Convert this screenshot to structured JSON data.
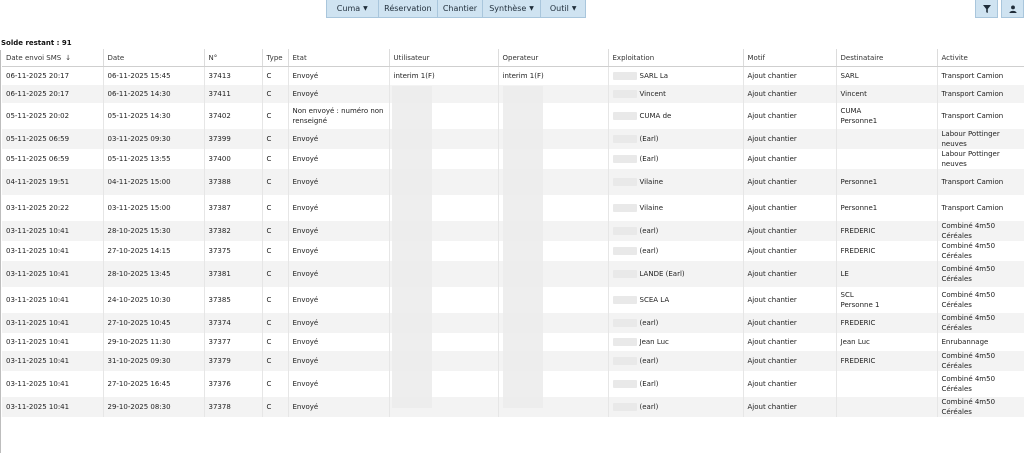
{
  "menu": [
    {
      "label": "Cuma",
      "caret": true,
      "w": 0
    },
    {
      "label": "Réservation",
      "caret": false
    },
    {
      "label": "Chantier",
      "caret": false
    },
    {
      "label": "Synthèse",
      "caret": true
    },
    {
      "label": "Outil",
      "caret": true
    }
  ],
  "solde": "Solde restant : 91",
  "columns": [
    "Date envoi SMS",
    "Date",
    "N°",
    "Type",
    "Etat",
    "Utilisateur",
    "Operateur",
    "Exploitation",
    "Motif",
    "Destinataire",
    "Activite"
  ],
  "rows": [
    {
      "date_envoi": "06-11-2025 20:17",
      "date": "06-11-2025 15:45",
      "num": "37413",
      "type": "C",
      "etat": "Envoyé",
      "utilisateur": "interim 1(F)",
      "operateur": "interim 1(F)",
      "exploitation": "SARL La",
      "motif": "Ajout chantier",
      "destinataire": "SARL",
      "destinataire2": "",
      "activite": "Transport Camion",
      "tall": false
    },
    {
      "date_envoi": "06-11-2025 20:17",
      "date": "06-11-2025 14:30",
      "num": "37411",
      "type": "C",
      "etat": "Envoyé",
      "utilisateur": "",
      "operateur": "",
      "exploitation": "Vincent",
      "motif": "Ajout chantier",
      "destinataire": "Vincent",
      "destinataire2": "",
      "activite": "Transport Camion",
      "tall": false
    },
    {
      "date_envoi": "05-11-2025 20:02",
      "date": "05-11-2025 14:30",
      "num": "37402",
      "type": "C",
      "etat": "Non envoyé : numéro non renseigné",
      "utilisateur": "",
      "operateur": "",
      "exploitation": "CUMA de",
      "motif": "Ajout chantier",
      "destinataire": "CUMA",
      "destinataire2": "Personne1",
      "activite": "Transport Camion",
      "tall": true
    },
    {
      "date_envoi": "05-11-2025 06:59",
      "date": "03-11-2025 09:30",
      "num": "37399",
      "type": "C",
      "etat": "Envoyé",
      "utilisateur": "",
      "operateur": "",
      "exploitation": "(Earl)",
      "motif": "Ajout chantier",
      "destinataire": "",
      "destinataire2": "",
      "activite": "Labour Pottinger neuves",
      "tall": false
    },
    {
      "date_envoi": "05-11-2025 06:59",
      "date": "05-11-2025 13:55",
      "num": "37400",
      "type": "C",
      "etat": "Envoyé",
      "utilisateur": "",
      "operateur": "",
      "exploitation": "(Earl)",
      "motif": "Ajout chantier",
      "destinataire": "",
      "destinataire2": "",
      "activite": "Labour Pottinger neuves",
      "tall": false
    },
    {
      "date_envoi": "04-11-2025 19:51",
      "date": "04-11-2025 15:00",
      "num": "37388",
      "type": "C",
      "etat": "Envoyé",
      "utilisateur": "",
      "operateur": "",
      "exploitation": "Vilaine",
      "motif": "Ajout chantier",
      "destinataire": "",
      "destinataire2": "Personne1",
      "activite": "Transport Camion",
      "tall": true
    },
    {
      "date_envoi": "03-11-2025 20:22",
      "date": "03-11-2025 15:00",
      "num": "37387",
      "type": "C",
      "etat": "Envoyé",
      "utilisateur": "",
      "operateur": "",
      "exploitation": "Vilaine",
      "motif": "Ajout chantier",
      "destinataire": "",
      "destinataire2": "Personne1",
      "activite": "Transport Camion",
      "tall": true
    },
    {
      "date_envoi": "03-11-2025 10:41",
      "date": "28-10-2025 15:30",
      "num": "37382",
      "type": "C",
      "etat": "Envoyé",
      "utilisateur": "",
      "operateur": "",
      "exploitation": "(earl)",
      "motif": "Ajout chantier",
      "destinataire": "FREDERIC",
      "destinataire2": "",
      "activite": "Combiné 4m50 Céréales",
      "tall": false
    },
    {
      "date_envoi": "03-11-2025 10:41",
      "date": "27-10-2025 14:15",
      "num": "37375",
      "type": "C",
      "etat": "Envoyé",
      "utilisateur": "",
      "operateur": "",
      "exploitation": "(earl)",
      "motif": "Ajout chantier",
      "destinataire": "FREDERIC",
      "destinataire2": "",
      "activite": "Combiné 4m50 Céréales",
      "tall": false
    },
    {
      "date_envoi": "03-11-2025 10:41",
      "date": "28-10-2025 13:45",
      "num": "37381",
      "type": "C",
      "etat": "Envoyé",
      "utilisateur": "",
      "operateur": "",
      "exploitation": "LANDE (Earl)",
      "motif": "Ajout chantier",
      "destinataire": "LE",
      "destinataire2": "",
      "activite": "Combiné 4m50 Céréales",
      "tall": true
    },
    {
      "date_envoi": "03-11-2025 10:41",
      "date": "24-10-2025 10:30",
      "num": "37385",
      "type": "C",
      "etat": "Envoyé",
      "utilisateur": "",
      "operateur": "",
      "exploitation": "SCEA LA",
      "motif": "Ajout chantier",
      "destinataire": "SCL",
      "destinataire2": "Personne 1",
      "activite": "Combiné 4m50 Céréales",
      "tall": true
    },
    {
      "date_envoi": "03-11-2025 10:41",
      "date": "27-10-2025 10:45",
      "num": "37374",
      "type": "C",
      "etat": "Envoyé",
      "utilisateur": "",
      "operateur": "",
      "exploitation": "(earl)",
      "motif": "Ajout chantier",
      "destinataire": "FREDERIC",
      "destinataire2": "",
      "activite": "Combiné 4m50 Céréales",
      "tall": false
    },
    {
      "date_envoi": "03-11-2025 10:41",
      "date": "29-10-2025 11:30",
      "num": "37377",
      "type": "C",
      "etat": "Envoyé",
      "utilisateur": "",
      "operateur": "",
      "exploitation": "Jean Luc",
      "motif": "Ajout chantier",
      "destinataire": "Jean Luc",
      "destinataire2": "",
      "activite": "Enrubannage",
      "tall": false
    },
    {
      "date_envoi": "03-11-2025 10:41",
      "date": "31-10-2025 09:30",
      "num": "37379",
      "type": "C",
      "etat": "Envoyé",
      "utilisateur": "",
      "operateur": "",
      "exploitation": "(earl)",
      "motif": "Ajout chantier",
      "destinataire": "FREDERIC",
      "destinataire2": "",
      "activite": "Combiné 4m50 Céréales",
      "tall": false
    },
    {
      "date_envoi": "03-11-2025 10:41",
      "date": "27-10-2025 16:45",
      "num": "37376",
      "type": "C",
      "etat": "Envoyé",
      "utilisateur": "",
      "operateur": "",
      "exploitation": "(Earl)",
      "motif": "Ajout chantier",
      "destinataire": "",
      "destinataire2": "",
      "activite": "Combiné 4m50 Céréales",
      "tall": true
    },
    {
      "date_envoi": "03-11-2025 10:41",
      "date": "29-10-2025 08:30",
      "num": "37378",
      "type": "C",
      "etat": "Envoyé",
      "utilisateur": "",
      "operateur": "",
      "exploitation": "(earl)",
      "motif": "Ajout chantier",
      "destinataire": "",
      "destinataire2": "",
      "activite": "Combiné 4m50 Céréales",
      "tall": false
    }
  ]
}
